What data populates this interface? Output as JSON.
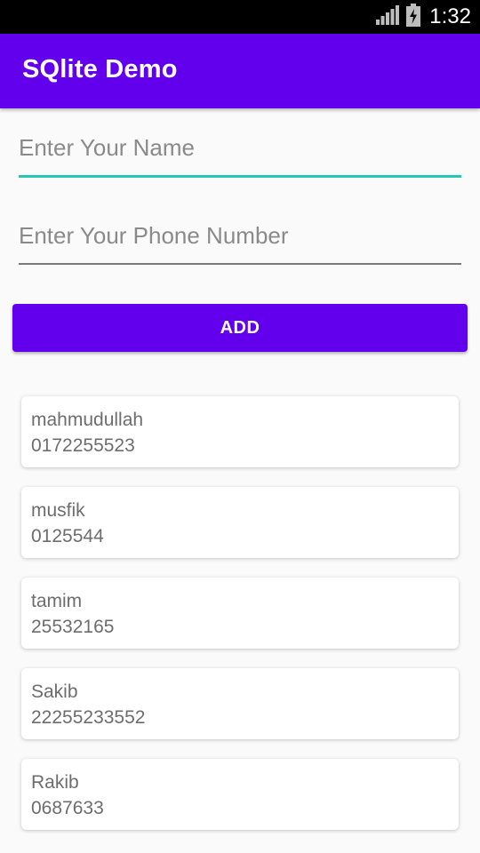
{
  "status_bar": {
    "time": "1:32",
    "icons": [
      "signal-icon",
      "battery-charging-icon"
    ]
  },
  "app_bar": {
    "title": "SQlite Demo",
    "color": "#6200ee"
  },
  "form": {
    "name_placeholder": "Enter Your Name",
    "name_value": "",
    "phone_placeholder": "Enter Your Phone Number",
    "phone_value": "",
    "add_label": "ADD",
    "focus_color": "#26c6b5"
  },
  "contacts": [
    {
      "name": "mahmudullah",
      "phone": "0172255523"
    },
    {
      "name": "musfik",
      "phone": "0125544"
    },
    {
      "name": "tamim",
      "phone": "25532165"
    },
    {
      "name": "Sakib",
      "phone": "22255233552"
    },
    {
      "name": "Rakib",
      "phone": "0687633"
    }
  ]
}
